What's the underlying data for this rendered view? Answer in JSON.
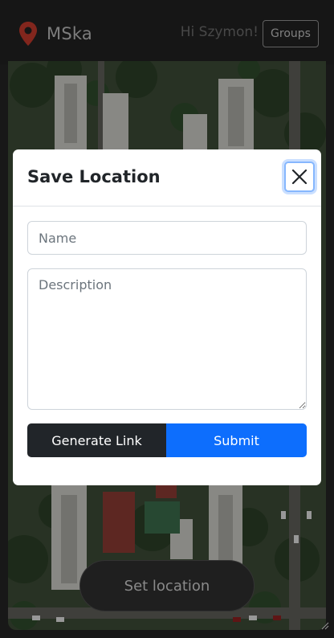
{
  "navbar": {
    "brand_name": "MSka",
    "brand_icon": "map-pin-icon",
    "greeting": "Hi Szymon!",
    "groups_label": "Groups"
  },
  "modal": {
    "title": "Save Location",
    "close_icon": "close-icon",
    "name_placeholder": "Name",
    "description_placeholder": "Description",
    "generate_link_label": "Generate Link",
    "submit_label": "Submit"
  },
  "map": {
    "set_location_label": "Set location"
  },
  "colors": {
    "primary": "#0d6efd",
    "dark": "#212529",
    "pin": "#c0392b"
  }
}
